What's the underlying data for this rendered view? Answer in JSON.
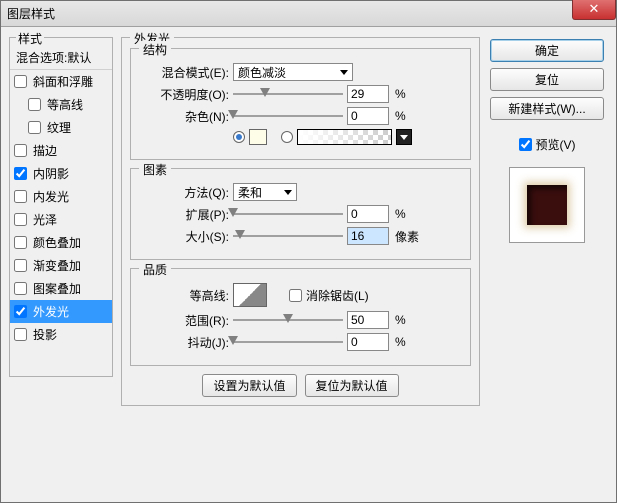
{
  "window": {
    "title": "图层样式"
  },
  "closeGlyph": "✕",
  "leftPanel": {
    "groupLabel": "样式",
    "blendHeader": "混合选项:默认",
    "items": [
      {
        "label": "斜面和浮雕",
        "checked": false,
        "indent": false
      },
      {
        "label": "等高线",
        "checked": false,
        "indent": true
      },
      {
        "label": "纹理",
        "checked": false,
        "indent": true
      },
      {
        "label": "描边",
        "checked": false,
        "indent": false
      },
      {
        "label": "内阴影",
        "checked": true,
        "indent": false
      },
      {
        "label": "内发光",
        "checked": false,
        "indent": false
      },
      {
        "label": "光泽",
        "checked": false,
        "indent": false
      },
      {
        "label": "颜色叠加",
        "checked": false,
        "indent": false
      },
      {
        "label": "渐变叠加",
        "checked": false,
        "indent": false
      },
      {
        "label": "图案叠加",
        "checked": false,
        "indent": false
      },
      {
        "label": "外发光",
        "checked": true,
        "indent": false,
        "selected": true
      },
      {
        "label": "投影",
        "checked": false,
        "indent": false
      }
    ]
  },
  "main": {
    "title": "外发光",
    "structure": {
      "legend": "结构",
      "blendModeLabel": "混合模式(E):",
      "blendModeValue": "颜色减淡",
      "opacityLabel": "不透明度(O):",
      "opacityValue": "29",
      "opacityUnit": "%",
      "noiseLabel": "杂色(N):",
      "noiseValue": "0",
      "noiseUnit": "%",
      "solidSelected": true
    },
    "element": {
      "legend": "图素",
      "methodLabel": "方法(Q):",
      "methodValue": "柔和",
      "spreadLabel": "扩展(P):",
      "spreadValue": "0",
      "spreadUnit": "%",
      "sizeLabel": "大小(S):",
      "sizeValue": "16",
      "sizeUnit": "像素"
    },
    "quality": {
      "legend": "品质",
      "contourLabel": "等高线:",
      "antiAliasLabel": "消除锯齿(L)",
      "antiAliasChecked": false,
      "rangeLabel": "范围(R):",
      "rangeValue": "50",
      "rangeUnit": "%",
      "jitterLabel": "抖动(J):",
      "jitterValue": "0",
      "jitterUnit": "%"
    },
    "setDefault": "设置为默认值",
    "resetDefault": "复位为默认值"
  },
  "right": {
    "ok": "确定",
    "cancel": "复位",
    "newStyle": "新建样式(W)...",
    "previewLabel": "预览(V)",
    "previewChecked": true
  }
}
